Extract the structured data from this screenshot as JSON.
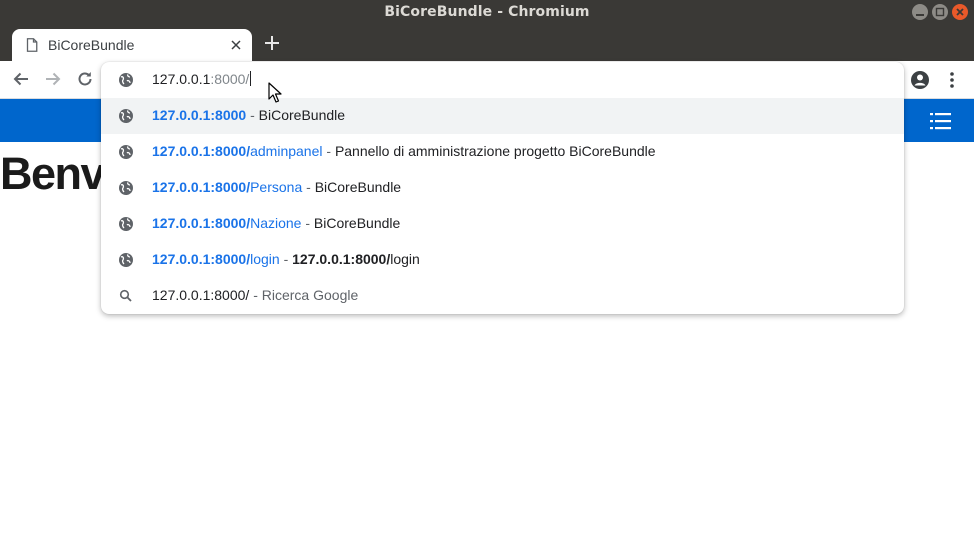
{
  "window": {
    "title": "BiCoreBundle - Chromium",
    "colors": {
      "titlebar": "#3a3936",
      "close": "#e9592a"
    }
  },
  "tabs": [
    {
      "title": "BiCoreBundle",
      "icon": "page-icon"
    }
  ],
  "toolbar": {
    "icons": [
      "back-arrow-icon",
      "forward-arrow-icon",
      "reload-icon",
      "profile-icon",
      "menu-dots-icon"
    ]
  },
  "omnibox": {
    "input_typed": "127.0.0.1",
    "input_autocomplete": ":8000/",
    "suggestions": [
      {
        "icon": "globe-icon",
        "url_bold": "127.0.0.1:8000",
        "url_rest": "",
        "separator": " - ",
        "desc": "BiCoreBundle"
      },
      {
        "icon": "globe-icon",
        "url_bold": "127.0.0.1:8000/",
        "url_rest": "adminpanel",
        "separator": " - ",
        "desc": "Pannello di amministrazione progetto BiCoreBundle"
      },
      {
        "icon": "globe-icon",
        "url_bold": "127.0.0.1:8000/",
        "url_rest": "Persona",
        "separator": " - ",
        "desc": "BiCoreBundle"
      },
      {
        "icon": "globe-icon",
        "url_bold": "127.0.0.1:8000/",
        "url_rest": "Nazione",
        "separator": " - ",
        "desc": "BiCoreBundle"
      },
      {
        "icon": "globe-icon",
        "url_bold": "127.0.0.1:8000/",
        "url_rest": "login",
        "separator": " - ",
        "desc_bold": "127.0.0.1:8000/",
        "desc": "login"
      },
      {
        "icon": "search-icon",
        "query": "127.0.0.1:8000/",
        "separator": " - ",
        "desc": "Ricerca Google"
      }
    ]
  },
  "page": {
    "navbar_color": "#0066cc",
    "heading": "Benve"
  }
}
